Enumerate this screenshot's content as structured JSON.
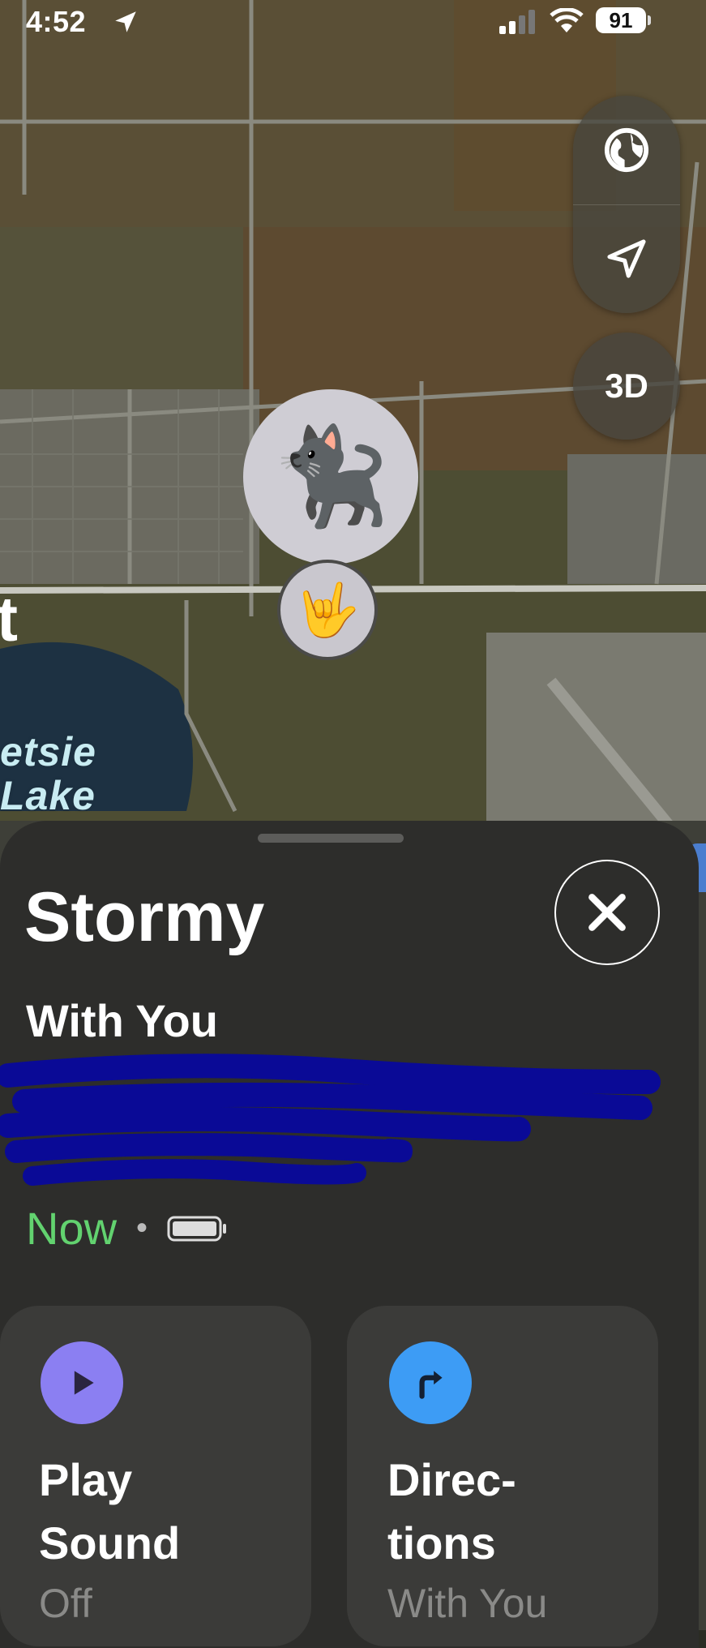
{
  "status_bar": {
    "time": "4:52",
    "battery": "91"
  },
  "map": {
    "controls": {
      "threed_label": "3D"
    },
    "pins": {
      "item_emoji": "🐈‍⬛",
      "me_emoji": "🤟"
    },
    "partial_label": "t",
    "lake_label_line1": "etsie",
    "lake_label_line2": "Lake"
  },
  "sheet": {
    "title": "Stormy",
    "subtitle": "With You",
    "status_time": "Now",
    "separator": "•",
    "actions": [
      {
        "label_line1": "Play",
        "label_line2": "Sound",
        "sub": "Off",
        "icon": "play-icon",
        "color": "#8b7ff2"
      },
      {
        "label_line1": "Direc-",
        "label_line2": "tions",
        "sub": "With You",
        "icon": "directions-arrow-icon",
        "color": "#3d9cf5"
      }
    ]
  },
  "colors": {
    "now_green": "#62d26f",
    "sheet_bg": "#2d2d2b",
    "redaction": "#0a0a96"
  }
}
